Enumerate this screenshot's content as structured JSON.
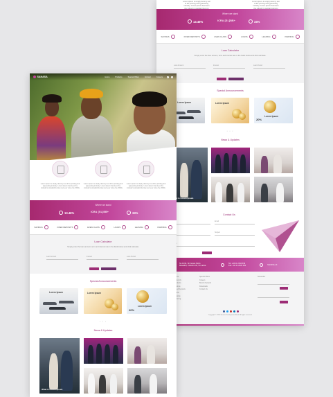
{
  "colors": {
    "brand": "#9c2c75",
    "brand_light": "#d886c9",
    "bg": "#e7e7e9"
  },
  "nav": {
    "logo": "SANASA",
    "links": [
      "Home",
      "Products",
      "Special Offers",
      "Contact",
      "Careers"
    ]
  },
  "features": [
    {
      "icon": "savings-jar-icon",
      "text": "Lorem ipsum is simply dummy text of the printing and typesetting industry. Lorem Ipsum has been the industry's standard dummy text ever since the 1500s"
    },
    {
      "icon": "document-icon",
      "text": "Lorem ipsum is simply dummy text of the printing and typesetting industry. Lorem Ipsum has been the industry's standard dummy text ever since the 1500s"
    },
    {
      "icon": "family-icon",
      "text": "Lorem ipsum is simply dummy text of the printing and typesetting industry. Lorem Ipsum has been the industry's standard dummy text ever since the 1500s"
    }
  ],
  "rates": {
    "title": "Where we stand",
    "left_value": "13.46%",
    "icra": "ICRA",
    "grade": "[SL]BB+",
    "right_value": "34%"
  },
  "links_strip": [
    "SAVINGS",
    "FIXED DEPOSITS",
    "EVEN CLASS",
    "LOANS",
    "LEASING",
    "PAWNING"
  ],
  "calculator": {
    "title": "Loan Calculator",
    "text": "Simply enter the loan amount, term and interest rate in the fields below and click calculate.",
    "fields": [
      "Loan Amount",
      "Interest",
      "Loan Period"
    ],
    "buttons": [
      "Calculate",
      "Reset"
    ]
  },
  "announcements": {
    "title": "Special Announcements",
    "cards": [
      {
        "label": "Lorem Ipsum"
      },
      {
        "label": "Lorem Ipsum"
      },
      {
        "label": "Lorem Ipsum",
        "badge": "20%"
      }
    ],
    "dots": "• • •"
  },
  "news": {
    "title": "News & Updates",
    "caption": "What is Lorem Ipsum"
  },
  "contact": {
    "title": "Contact Us",
    "fields": [
      "Name",
      "Email",
      "Phone",
      "Subject",
      "Message"
    ],
    "submit": "Submit",
    "address": "No 12/11, Sir James Peiris Mawatha, Colombo 02, Sri Lanka",
    "phone": "Tel: +94 11 2444 449",
    "fax": "Fax: +94 11 2433 103",
    "web": "SANASA.LK"
  },
  "footer": {
    "col1": [
      "Home",
      "About Us",
      "Products",
      "Savings",
      "Fixed Deposits",
      "Loans",
      "Leasing",
      "Pawning"
    ],
    "col2": [
      "Special Offers",
      "Careers",
      "Branch Network",
      "Downloads",
      "Contact Us"
    ],
    "newsletter": "Newsletter",
    "signup": "Sign Up",
    "copyright": "Copyright © 2019 Sanasa Development Bank. All rights reserved."
  }
}
